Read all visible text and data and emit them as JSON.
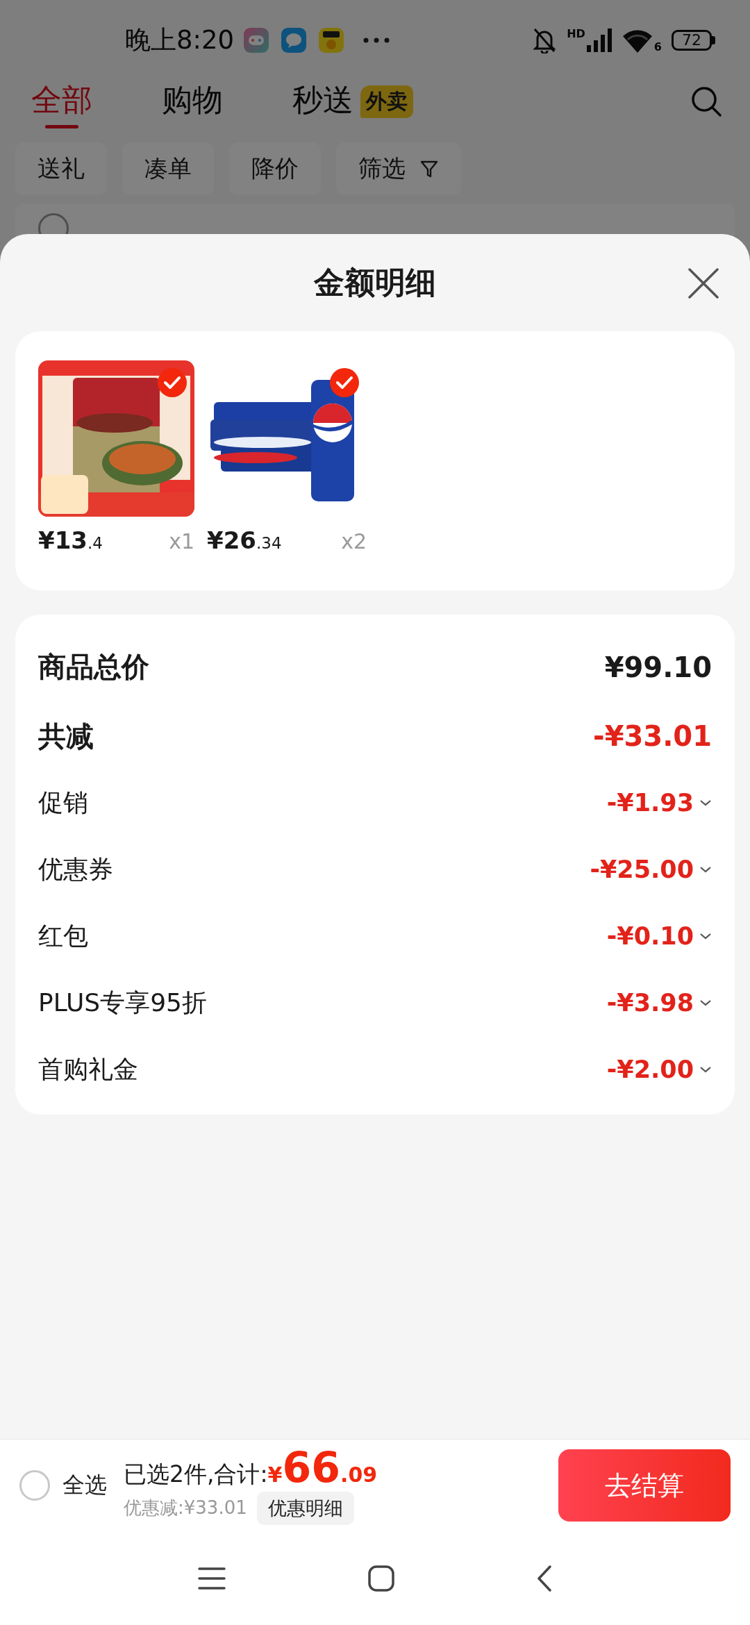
{
  "status_bar": {
    "time": "晚上8:20",
    "network": "HD",
    "wifi": "6",
    "battery": "72"
  },
  "tabs": [
    {
      "label": "全部",
      "selected": true
    },
    {
      "label": "购物",
      "selected": false
    },
    {
      "label": "秒送",
      "badge": "外卖",
      "selected": false
    }
  ],
  "filters": [
    {
      "label": "送礼",
      "kind": "plain"
    },
    {
      "label": "凑单",
      "kind": "plain"
    },
    {
      "label": "降价",
      "kind": "plain"
    },
    {
      "label": "筛选",
      "kind": "filter"
    }
  ],
  "sheet": {
    "title": "金额明细",
    "products": [
      {
        "kind": "picture",
        "price": "¥13",
        "price_decimal": ".4",
        "quantity": "x1",
        "checked": true
      },
      {
        "kind": "picture",
        "price": "¥26",
        "price_decimal": ".34",
        "quantity": "x2",
        "checked": true
      }
    ],
    "rows": [
      {
        "label": "商品总价",
        "amount": "¥99.10",
        "kind": "total"
      },
      {
        "label": "共减",
        "amount": "-¥33.01",
        "kind": "saving"
      },
      {
        "label": "促销",
        "amount": "-¥1.93",
        "kind": "discount"
      },
      {
        "label": "优惠券",
        "amount": "-¥25.00",
        "kind": "discount"
      },
      {
        "label": "红包",
        "amount": "-¥0.10",
        "kind": "discount"
      },
      {
        "label": "PLUS专享95折",
        "amount": "-¥3.98",
        "kind": "discount"
      },
      {
        "label": "首购礼金",
        "amount": "-¥2.00",
        "kind": "discount"
      }
    ]
  },
  "footer": {
    "select_all": {
      "label": "全选",
      "checked": false
    },
    "summary": "已选2件,合计:",
    "total": {
      "currency": "¥",
      "integer": "66",
      "decimal": ".09"
    },
    "saving": "优惠减:¥33.01",
    "detail_button": "优惠明细",
    "checkout": "去结算"
  }
}
